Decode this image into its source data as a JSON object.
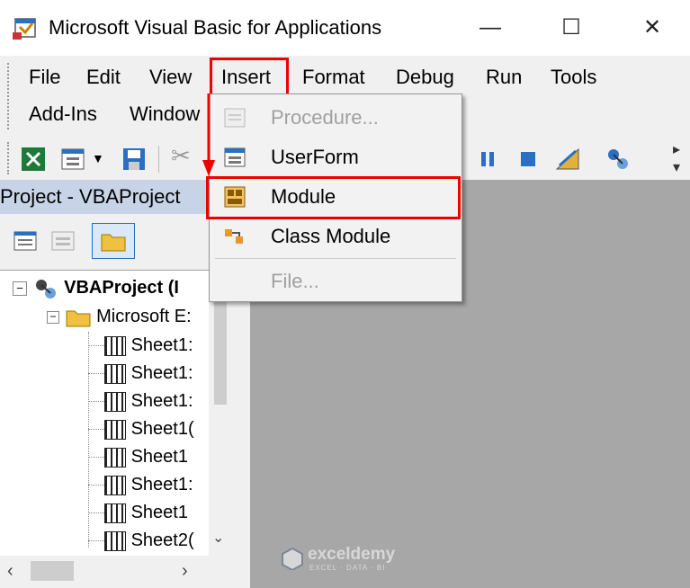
{
  "window": {
    "title": "Microsoft Visual Basic for Applications",
    "minimize": "—",
    "maximize": "☐",
    "close": "✕"
  },
  "menu": {
    "file": "File",
    "edit": "Edit",
    "view": "View",
    "insert": "Insert",
    "format": "Format",
    "debug": "Debug",
    "run": "Run",
    "tools": "Tools",
    "addins": "Add-Ins",
    "window": "Window"
  },
  "dropdown": {
    "items": [
      {
        "label": "Procedure...",
        "enabled": false
      },
      {
        "label": "UserForm",
        "enabled": true
      },
      {
        "label": "Module",
        "enabled": true
      },
      {
        "label": "Class Module",
        "enabled": true
      },
      {
        "label": "File...",
        "enabled": false
      }
    ]
  },
  "project": {
    "title": "Project - VBAProject",
    "root": "VBAProject (I",
    "folder": "Microsoft E:",
    "sheets": [
      "Sheet1:",
      "Sheet1:",
      "Sheet1:",
      "Sheet1(",
      "Sheet1",
      "Sheet1:",
      "Sheet1",
      "Sheet2("
    ]
  },
  "watermark": {
    "name": "exceldemy",
    "tagline": "EXCEL · DATA · BI"
  },
  "colors": {
    "highlight": "#e00000",
    "workspace": "#a7a7a7",
    "project_header": "#c7d3e6"
  }
}
